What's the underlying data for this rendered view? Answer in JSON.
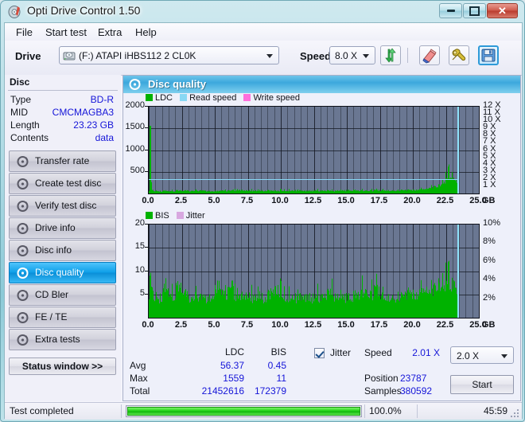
{
  "window": {
    "title": "Opti Drive Control 1.50",
    "icon": "disc-icon",
    "buttons": {
      "minimize": "minimize-icon",
      "maximize": "maximize-icon",
      "close": "close-icon"
    }
  },
  "menu": {
    "items": [
      "File",
      "Start test",
      "Extra",
      "Help"
    ]
  },
  "toolbar": {
    "drive_label": "Drive",
    "drive_value": "(F:)  ATAPI iHBS112  2 CL0K",
    "speed_label": "Speed",
    "speed_value": "8.0 X",
    "buttons": [
      {
        "name": "refresh-button",
        "icon": "refresh-arrows-icon"
      },
      {
        "name": "erase-button",
        "icon": "eraser-icon"
      },
      {
        "name": "tools-button",
        "icon": "wrench-icon"
      },
      {
        "name": "save-button",
        "icon": "floppy-disk-icon"
      }
    ]
  },
  "sidebar": {
    "disc_header": "Disc",
    "disc_rows": [
      {
        "key": "Type",
        "value": "BD-R"
      },
      {
        "key": "MID",
        "value": "CMCMAGBA3"
      },
      {
        "key": "Length",
        "value": "23.23 GB"
      },
      {
        "key": "Contents",
        "value": "data"
      }
    ],
    "items": [
      {
        "label": "Transfer rate",
        "selected": false
      },
      {
        "label": "Create test disc",
        "selected": false
      },
      {
        "label": "Verify test disc",
        "selected": false
      },
      {
        "label": "Drive info",
        "selected": false
      },
      {
        "label": "Disc info",
        "selected": false
      },
      {
        "label": "Disc quality",
        "selected": true
      },
      {
        "label": "CD Bler",
        "selected": false
      },
      {
        "label": "FE / TE",
        "selected": false
      },
      {
        "label": "Extra tests",
        "selected": false
      }
    ],
    "status_window_button": "Status window >>"
  },
  "main": {
    "panel_title": "Disc quality",
    "panel_icon": "disc-quality-icon"
  },
  "stats": {
    "col_ldc": "LDC",
    "col_bis": "BIS",
    "rows": [
      {
        "label": "Avg",
        "ldc": "56.37",
        "bis": "0.45"
      },
      {
        "label": "Max",
        "ldc": "1559",
        "bis": "11"
      },
      {
        "label": "Total",
        "ldc": "21452616",
        "bis": "172379"
      }
    ],
    "jitter_label": "Jitter",
    "jitter_checked": true,
    "speed_label": "Speed",
    "speed_value": "2.01 X",
    "position_label": "Position",
    "position_value": "23787",
    "samples_label": "Samples",
    "samples_value": "380592",
    "speed_select": "2.0 X",
    "start_button": "Start"
  },
  "statusbar": {
    "text": "Test completed",
    "progress_percent": "100.0%",
    "progress_fill": 100,
    "elapsed": "45:59"
  },
  "colors": {
    "ldc_green": "#00b200",
    "bis_green": "#00b200",
    "read_speed": "#88d8f4",
    "write_speed": "#ff6fdc",
    "jitter": "#d8a8e0",
    "plot_bg": "#6a7792",
    "accent_blue": "#1515d8",
    "cursor": "#8fe3fb"
  },
  "chart_data": [
    {
      "type": "area",
      "name": "disc-quality-ldc-chart",
      "title": "LDC / Read speed",
      "xlabel": "GB",
      "ylabel": "LDC",
      "xlim": [
        0.0,
        25.0
      ],
      "xticks": [
        "0.0",
        "2.5",
        "5.0",
        "7.5",
        "10.0",
        "12.5",
        "15.0",
        "17.5",
        "20.0",
        "22.5",
        "25.0"
      ],
      "xunit": "GB",
      "ylim": [
        0,
        2000
      ],
      "yticks": [
        500,
        1000,
        1500,
        2000
      ],
      "y2lim": [
        0,
        12
      ],
      "y2ticks": [
        "1 X",
        "2 X",
        "3 X",
        "4 X",
        "5 X",
        "6 X",
        "7 X",
        "8 X",
        "9 X",
        "10 X",
        "11 X",
        "12 X"
      ],
      "grid": true,
      "legend": [
        {
          "label": "LDC",
          "color": "#00b200"
        },
        {
          "label": "Read speed",
          "color": "#88d8f4"
        },
        {
          "label": "Write speed",
          "color": "#ff6fdc"
        }
      ],
      "series": [
        {
          "name": "LDC",
          "color": "#00b200",
          "note": "dense spiky area series, baseline ~40-70, spike to 1559 at x~0.05, rising cluster 21.8-23.4 GB peaking near 480",
          "x": [
            0.0,
            0.05,
            0.2,
            0.5,
            1.0,
            1.5,
            2.0,
            2.5,
            3.0,
            3.5,
            4.0,
            4.5,
            5.0,
            5.5,
            6.0,
            6.5,
            7.0,
            7.5,
            8.0,
            8.5,
            9.0,
            9.5,
            10.0,
            10.5,
            11.0,
            11.5,
            12.0,
            12.5,
            13.0,
            13.5,
            14.0,
            14.5,
            15.0,
            15.5,
            16.0,
            16.5,
            17.0,
            17.5,
            18.0,
            18.5,
            19.0,
            19.5,
            20.0,
            20.5,
            21.0,
            21.3,
            21.6,
            21.9,
            22.1,
            22.3,
            22.5,
            22.7,
            22.9,
            23.1,
            23.3,
            23.4
          ],
          "y": [
            60,
            1559,
            70,
            55,
            50,
            48,
            52,
            55,
            60,
            58,
            62,
            55,
            50,
            58,
            60,
            70,
            66,
            62,
            58,
            60,
            64,
            60,
            58,
            62,
            66,
            60,
            58,
            62,
            60,
            64,
            58,
            62,
            66,
            70,
            64,
            60,
            62,
            66,
            70,
            68,
            72,
            70,
            76,
            82,
            96,
            120,
            140,
            170,
            210,
            260,
            300,
            380,
            440,
            300,
            260,
            60
          ]
        },
        {
          "name": "Read speed",
          "color": "#88d8f4",
          "note": "flat line at about 2.0X from 0 to 23.4 GB",
          "x": [
            0.0,
            23.4
          ],
          "y": [
            2.0,
            2.0
          ],
          "axis": "y2"
        },
        {
          "name": "Write speed",
          "color": "#ff6fdc",
          "x": [],
          "y": []
        }
      ],
      "cursor_x": 23.4
    },
    {
      "type": "area",
      "name": "disc-quality-bis-chart",
      "title": "BIS / Jitter",
      "xlabel": "GB",
      "ylabel": "BIS",
      "xlim": [
        0.0,
        25.0
      ],
      "xticks": [
        "0.0",
        "2.5",
        "5.0",
        "7.5",
        "10.0",
        "12.5",
        "15.0",
        "17.5",
        "20.0",
        "22.5",
        "25.0"
      ],
      "xunit": "GB",
      "ylim": [
        0,
        20
      ],
      "yticks": [
        5,
        10,
        15,
        20
      ],
      "y2lim": [
        0,
        10
      ],
      "y2ticks": [
        "2%",
        "4%",
        "6%",
        "8%",
        "10%"
      ],
      "grid": true,
      "legend": [
        {
          "label": "BIS",
          "color": "#00b200"
        },
        {
          "label": "Jitter",
          "color": "#d8a8e0"
        }
      ],
      "series": [
        {
          "name": "BIS",
          "color": "#00b200",
          "note": "dense noisy area, baseline ~3-4, frequent spikes to 5-7, max 11 near 22.8 GB, initial spike 9 at x~0.05",
          "x": [
            0.0,
            0.05,
            0.3,
            0.8,
            1.3,
            1.8,
            2.3,
            2.8,
            3.3,
            3.8,
            4.3,
            4.8,
            5.3,
            5.4,
            5.8,
            6.3,
            6.4,
            6.8,
            7.3,
            7.8,
            8.3,
            8.8,
            9.3,
            9.8,
            10.0,
            10.3,
            10.8,
            11.3,
            11.8,
            12.3,
            12.8,
            13.3,
            13.8,
            14.2,
            14.8,
            15.3,
            15.8,
            16.3,
            16.8,
            17.3,
            17.8,
            18.3,
            18.8,
            19.3,
            19.8,
            20.3,
            20.8,
            21.3,
            21.8,
            22.0,
            22.3,
            22.5,
            22.7,
            22.8,
            23.0,
            23.2,
            23.4
          ],
          "y": [
            4,
            9,
            4.5,
            4,
            5.5,
            4,
            5.5,
            4.5,
            4,
            4.2,
            4,
            4.5,
            7,
            5,
            4.5,
            7,
            5,
            4,
            4.5,
            4,
            4.2,
            4,
            5.5,
            6,
            4.5,
            4,
            4.2,
            4,
            4.5,
            4,
            4.2,
            4.5,
            5.5,
            4,
            4.2,
            4,
            5,
            5.5,
            4.5,
            5.5,
            4,
            4.5,
            4.2,
            4.5,
            5,
            4.5,
            5.5,
            5,
            6.5,
            8,
            8.5,
            9,
            11,
            10.5,
            9,
            6,
            4
          ]
        },
        {
          "name": "Jitter",
          "color": "#d8a8e0",
          "x": [],
          "y": [],
          "axis": "y2"
        }
      ],
      "cursor_x": 23.4
    }
  ]
}
